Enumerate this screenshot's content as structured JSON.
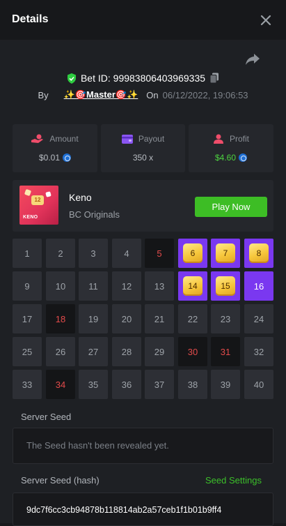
{
  "header": {
    "title": "Details"
  },
  "bet": {
    "id_text": "Bet ID: 99983806403969335",
    "by_label": "By",
    "username": "✨🎯Master🎯✨",
    "on_label": "On",
    "date": "06/12/2022, 19:06:53"
  },
  "stats": [
    {
      "label": "Amount",
      "value": "$0.01",
      "coin": true,
      "color": "#b8bcc2"
    },
    {
      "label": "Payout",
      "value": "350 x",
      "coin": false,
      "color": "#b8bcc2"
    },
    {
      "label": "Profit",
      "value": "$4.60",
      "coin": true,
      "color": "#4cd23f"
    }
  ],
  "game": {
    "name": "Keno",
    "provider": "BC Originals",
    "thumb_ball": "12",
    "thumb_label": "KENO",
    "play_label": "Play Now"
  },
  "keno": {
    "numbers": [
      1,
      2,
      3,
      4,
      5,
      6,
      7,
      8,
      9,
      10,
      11,
      12,
      13,
      14,
      15,
      16,
      17,
      18,
      19,
      20,
      21,
      22,
      23,
      24,
      25,
      26,
      27,
      28,
      29,
      30,
      31,
      32,
      33,
      34,
      35,
      36,
      37,
      38,
      39,
      40
    ],
    "hits": [
      6,
      7,
      8,
      14,
      15
    ],
    "picked": [
      16
    ],
    "misses": [
      5,
      18,
      30,
      31,
      34
    ]
  },
  "server_seed": {
    "label": "Server Seed",
    "placeholder": "The Seed hasn't been revealed yet."
  },
  "server_seed_hash": {
    "label": "Server Seed (hash)",
    "link": "Seed Settings",
    "value": "9dc7f6cc3cb94878b118814ab2a57ceb1f1b01b9ff4"
  },
  "colors": {
    "accent_green": "#3dbd25",
    "hit_purple": "#7a38f0",
    "miss_red": "#e34b4b"
  }
}
